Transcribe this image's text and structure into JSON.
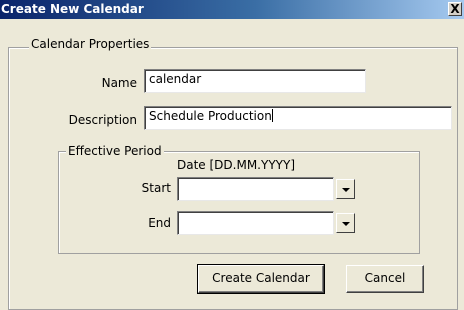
{
  "window": {
    "title": "Create New Calendar",
    "close_glyph": "X"
  },
  "properties": {
    "legend": "Calendar Properties",
    "name_label": "Name",
    "name_value": "calendar",
    "description_label": "Description",
    "description_value": "Schedule Production"
  },
  "effective_period": {
    "legend": "Effective Period",
    "date_format_label": "Date [DD.MM.YYYY]",
    "start_label": "Start",
    "start_value": "",
    "end_label": "End",
    "end_value": ""
  },
  "buttons": {
    "create_label": "Create Calendar",
    "cancel_label": "Cancel"
  },
  "colors": {
    "title_gradient_start": "#0a246a",
    "title_gradient_end": "#a6caf0",
    "dialog_background": "#ece9d8"
  }
}
